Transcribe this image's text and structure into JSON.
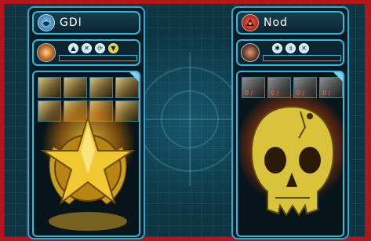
{
  "gdi": {
    "name": "GDI",
    "emblem_icon": "gdi-eagle-icon",
    "victory_icon": "gold-star-laurel-icon",
    "order_icons": [
      "up-arrow-icon",
      "close-icon",
      "cycle-icon",
      "down-chevron-icon"
    ],
    "unit_tiles": 8
  },
  "nod": {
    "name": "Nod",
    "emblem_icon": "nod-scorpion-icon",
    "defeat_icon": "skull-icon",
    "order_icons": [
      "gear-icon",
      "pause-icon",
      "close-icon"
    ],
    "tile_labels": [
      "0 /",
      "0 /",
      "0 /",
      "0 /"
    ]
  },
  "colors": {
    "frame_border": "#b3151c",
    "panel_border": "#2fa9cf",
    "gdi_glow": "#ffd23c",
    "nod_glow": "#e6460a"
  }
}
